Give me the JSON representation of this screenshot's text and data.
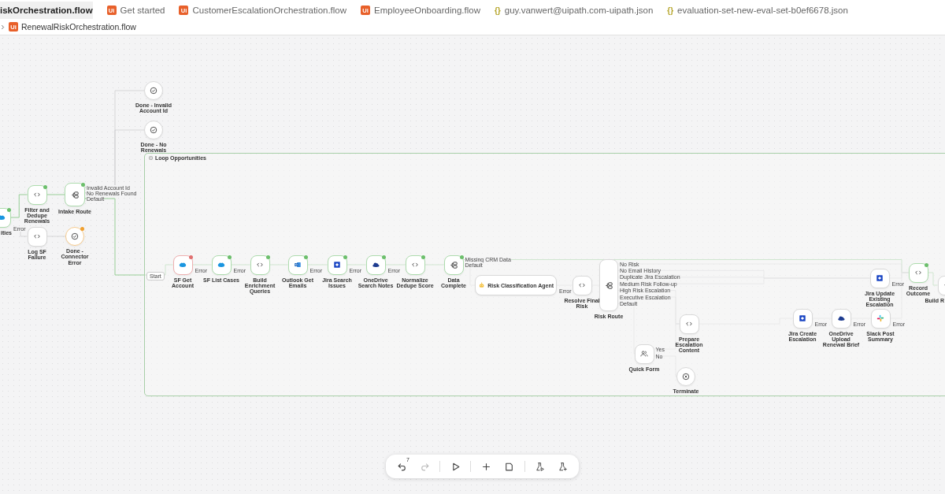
{
  "tabs": [
    {
      "label": "iskOrchestration.flow",
      "kind": "plain",
      "selected": true
    },
    {
      "label": "Get started",
      "kind": "ui",
      "icon": "Ui",
      "selected": false
    },
    {
      "label": "CustomerEscalationOrchestration.flow",
      "kind": "ui",
      "icon": "Ui",
      "selected": false
    },
    {
      "label": "EmployeeOnboarding.flow",
      "kind": "ui",
      "icon": "Ui",
      "selected": false
    },
    {
      "label": "guy.vanwert@uipath.com-uipath.json",
      "kind": "json",
      "icon": "{}",
      "selected": false
    },
    {
      "label": "evaluation-set-new-eval-set-b0ef6678.json",
      "kind": "json",
      "icon": "{}",
      "selected": false
    }
  ],
  "breadcrumb": {
    "icon": "Ui",
    "label": "RenewalRiskOrchestration.flow"
  },
  "loop": {
    "title": "Loop Opportunities",
    "start": "Start"
  },
  "nodes": [
    {
      "label": "ities",
      "kind": "salesforce",
      "color": "#6cbf6c",
      "outputs": [
        "Error"
      ]
    },
    {
      "label": "Filter and Dedupe Renewals",
      "kind": "code",
      "color": "#6cbf6c"
    },
    {
      "label": "Intake Route",
      "kind": "router",
      "color": "#6cbf6c",
      "outputs": [
        "Invalid Account Id",
        "No Renewals Found",
        "Default"
      ]
    },
    {
      "label": "Done - Invalid Account Id",
      "kind": "end"
    },
    {
      "label": "Done - No Renewals",
      "kind": "end"
    },
    {
      "label": "Log SF Failure",
      "kind": "code"
    },
    {
      "label": "Done - Connector Error",
      "kind": "end",
      "color": "#f0a030"
    },
    {
      "label": "SF Get Account",
      "kind": "salesforce",
      "color": "#e07070",
      "outputs": [
        "Error"
      ]
    },
    {
      "label": "SF List Cases",
      "kind": "salesforce",
      "color": "#6cbf6c",
      "outputs": [
        "Error"
      ]
    },
    {
      "label": "Build Enrichment Queries",
      "kind": "code",
      "color": "#6cbf6c"
    },
    {
      "label": "Outlook Get Emails",
      "kind": "outlook",
      "color": "#6cbf6c",
      "outputs": [
        "Error"
      ]
    },
    {
      "label": "Jira Search Issues",
      "kind": "jira",
      "color": "#6cbf6c",
      "outputs": [
        "Error"
      ]
    },
    {
      "label": "OneDrive Search Notes",
      "kind": "onedrive",
      "color": "#6cbf6c",
      "outputs": [
        "Error"
      ]
    },
    {
      "label": "Normalize Dedupe Score",
      "kind": "code",
      "color": "#6cbf6c"
    },
    {
      "label": "Data Complete",
      "kind": "router",
      "color": "#6cbf6c",
      "outputs": [
        "Missing CRM Data",
        "Default"
      ]
    },
    {
      "label": "Risk Classification Agent",
      "kind": "agent",
      "outputs": [
        "Error"
      ]
    },
    {
      "label": "Resolve Final Risk",
      "kind": "code"
    },
    {
      "label": "Risk Route",
      "kind": "router",
      "outputs": [
        "No Risk",
        "No Email History",
        "Duplicate Jira Escalation",
        "Medium Risk Follow-up",
        "High Risk Escalation",
        "Executive Escalation",
        "Default"
      ]
    },
    {
      "label": "Prepare Escalation Content",
      "kind": "code"
    },
    {
      "label": "Quick Form",
      "kind": "form",
      "outputs": [
        "Yes",
        "No"
      ]
    },
    {
      "label": "Terminate",
      "kind": "terminate"
    },
    {
      "label": "Jira Update Existing Escalation",
      "kind": "jira",
      "outputs": [
        "Error"
      ]
    },
    {
      "label": "Record Outcome",
      "kind": "code",
      "color": "#6cbf6c"
    },
    {
      "label": "Build R",
      "kind": "code"
    },
    {
      "label": "Jira Create Escalation",
      "kind": "jira",
      "outputs": [
        "Error"
      ]
    },
    {
      "label": "OneDrive Upload Renewal Brief",
      "kind": "onedrive",
      "outputs": [
        "Error"
      ]
    },
    {
      "label": "Slack Post Summary",
      "kind": "slack",
      "outputs": [
        "Error"
      ]
    }
  ],
  "toolbar": [
    {
      "kind": "undo",
      "count": "7",
      "disabled": false
    },
    {
      "kind": "redo",
      "disabled": true
    },
    {
      "kind": "divider"
    },
    {
      "kind": "run",
      "disabled": false
    },
    {
      "kind": "divider"
    },
    {
      "kind": "add",
      "disabled": false
    },
    {
      "kind": "note",
      "disabled": false
    },
    {
      "kind": "divider"
    },
    {
      "kind": "test-run",
      "disabled": false
    },
    {
      "kind": "test-add",
      "disabled": false
    }
  ]
}
